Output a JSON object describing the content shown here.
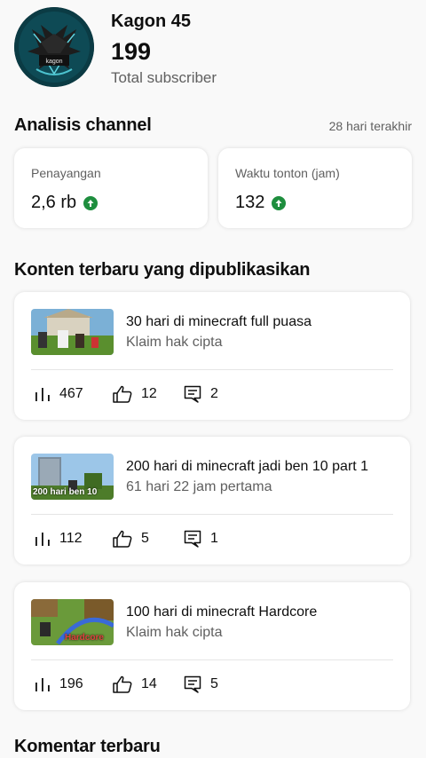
{
  "channel": {
    "name": "Kagon 45",
    "subscribers": "199",
    "subscribers_label": "Total subscriber",
    "avatar_text": "kagon"
  },
  "analytics": {
    "title": "Analisis channel",
    "period": "28 hari terakhir",
    "cards": [
      {
        "label": "Penayangan",
        "value": "2,6 rb",
        "trend": "up"
      },
      {
        "label": "Waktu tonton (jam)",
        "value": "132",
        "trend": "up"
      }
    ]
  },
  "recent": {
    "title": "Konten terbaru yang dipublikasikan",
    "videos": [
      {
        "title": "30 hari di minecraft full puasa",
        "subtitle": "Klaim hak cipta",
        "thumb_text": "",
        "views": "467",
        "likes": "12",
        "comments": "2"
      },
      {
        "title": "200 hari di minecraft jadi ben 10 part 1",
        "subtitle": "61 hari 22 jam pertama",
        "thumb_text": "200 hari ben 10",
        "views": "112",
        "likes": "5",
        "comments": "1"
      },
      {
        "title": "100 hari di minecraft Hardcore",
        "subtitle": "Klaim hak cipta",
        "thumb_text": "Hardcore",
        "views": "196",
        "likes": "14",
        "comments": "5"
      }
    ]
  },
  "comments": {
    "title": "Komentar terbaru"
  },
  "colors": {
    "accent_up": "#1e8e3e",
    "secondary_text": "#606060"
  }
}
